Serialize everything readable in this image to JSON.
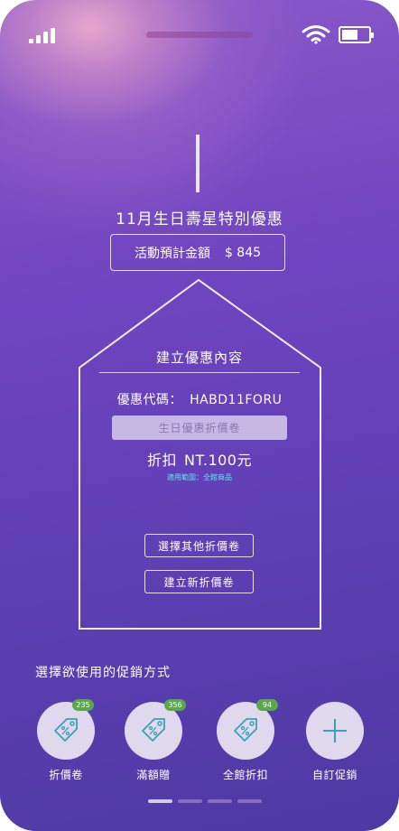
{
  "status_bar": {
    "signal_icon": "signal-bars-icon",
    "wifi_icon": "wifi-icon",
    "battery_icon": "battery-icon",
    "battery_level": 0.6
  },
  "event": {
    "title": "11月生日壽星特別優惠",
    "estimate_label": "活動預計金額",
    "estimate_value": "$ 845"
  },
  "coupon_card": {
    "title": "建立優惠內容",
    "code_label": "優惠代碼：",
    "code_value": "HABD11FORU",
    "coupon_type": "生日優惠折價卷",
    "discount_label": "折扣",
    "discount_value": "NT.100元",
    "scope": "適用範圍：全館商品",
    "choose_other_button": "選擇其他折價卷",
    "create_new_button": "建立新折價卷"
  },
  "promotions": {
    "heading": "選擇欲使用的促銷方式",
    "items": [
      {
        "label": "折價卷",
        "count": "235",
        "icon": "price-tag-icon"
      },
      {
        "label": "滿額贈",
        "count": "356",
        "icon": "price-tag-icon"
      },
      {
        "label": "全館折扣",
        "count": "94",
        "icon": "price-tag-icon"
      },
      {
        "label": "自訂促銷",
        "icon": "plus-icon"
      }
    ]
  },
  "pagination": {
    "total": 4,
    "active": 1
  },
  "colors": {
    "badge": "#5aa84a",
    "scope_text": "#5ee6f0",
    "icon_stroke": "#3aa0b5"
  }
}
